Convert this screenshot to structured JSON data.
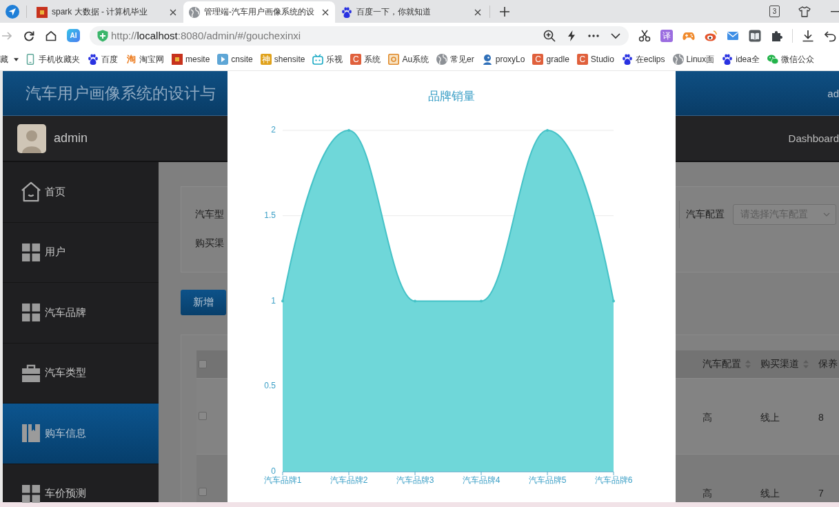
{
  "browser": {
    "tabs": [
      {
        "title": "spark 大数据 - 计算机毕业",
        "kind": "tile",
        "selected": false
      },
      {
        "title": "管理端-汽车用户画像系统的设",
        "kind": "globe",
        "selected": true
      },
      {
        "title": "百度一下，你就知道",
        "kind": "paw",
        "selected": false
      }
    ],
    "tab_count": "3",
    "forward_disabled": true,
    "ai_badge": "AI",
    "address": {
      "scheme": "http://",
      "host": "localhost",
      "path": ":8080/admin/#/gouchexinxi"
    },
    "translate_badge": "译",
    "bookmarks": {
      "overflow_label": "藏",
      "items": [
        {
          "label": "手机收藏夹",
          "kind": "phone"
        },
        {
          "label": "百度",
          "kind": "paw"
        },
        {
          "label": "淘宝网",
          "kind": "glyph",
          "glyph": "淘"
        },
        {
          "label": "mesite",
          "kind": "tile"
        },
        {
          "label": "cnsite",
          "kind": "play"
        },
        {
          "label": "shensite",
          "kind": "lettertile",
          "glyph": "神",
          "color": "#e0a21c"
        },
        {
          "label": "乐视",
          "kind": "tv"
        },
        {
          "label": "系统",
          "kind": "lettertile",
          "glyph": "C",
          "color": "#e0603c"
        },
        {
          "label": "Au系统",
          "kind": "frame"
        },
        {
          "label": "常见er",
          "kind": "globe"
        },
        {
          "label": "proxyLo",
          "kind": "person"
        },
        {
          "label": "gradle",
          "kind": "lettertile",
          "glyph": "C",
          "color": "#e0603c"
        },
        {
          "label": "Studio",
          "kind": "lettertile",
          "glyph": "C",
          "color": "#e0603c"
        },
        {
          "label": "在eclips",
          "kind": "paw"
        },
        {
          "label": "Linux面",
          "kind": "globe"
        },
        {
          "label": "idea全",
          "kind": "paw"
        },
        {
          "label": "微信公众",
          "kind": "chat"
        }
      ]
    }
  },
  "app": {
    "title": "汽车用户画像系统的设计与",
    "header_user": "ad",
    "user": "admin",
    "breadcrumb": "Dashboard",
    "menu": [
      {
        "label": "首页",
        "kind": "house",
        "selected": false
      },
      {
        "label": "用户",
        "kind": "grid",
        "selected": false
      },
      {
        "label": "汽车品牌",
        "kind": "grid",
        "selected": false
      },
      {
        "label": "汽车类型",
        "kind": "briefcase",
        "selected": false
      },
      {
        "label": "购车信息",
        "kind": "book",
        "selected": true
      },
      {
        "label": "车价预测",
        "kind": "grid",
        "selected": false
      }
    ],
    "search": {
      "type_label": "汽车型",
      "config_label": "汽车配置",
      "config_placeholder": "请选择汽车配置",
      "channel_label": "购买渠"
    },
    "add_button": "新增",
    "table": {
      "header_checked": false,
      "columns": [
        {
          "label": "汽车配置",
          "sortable": true
        },
        {
          "label": "购买渠道",
          "sortable": true
        },
        {
          "label": "保养",
          "sortable": false
        }
      ],
      "rows": [
        {
          "checked": false,
          "cells": [
            "高",
            "线上",
            "8"
          ]
        },
        {
          "checked": false,
          "cells": [
            "高",
            "线上",
            "7"
          ]
        }
      ]
    },
    "chart_modal": {
      "chart_data": {
        "type": "area",
        "title": "品牌销量",
        "categories": [
          "汽车品牌1",
          "汽车品牌2",
          "汽车品牌3",
          "汽车品牌4",
          "汽车品牌5",
          "汽车品牌6"
        ],
        "values": [
          1,
          2,
          1,
          1,
          2,
          1
        ],
        "ylim": [
          0,
          2
        ],
        "yticks": [
          0,
          0.5,
          1,
          1.5,
          2
        ]
      }
    }
  }
}
